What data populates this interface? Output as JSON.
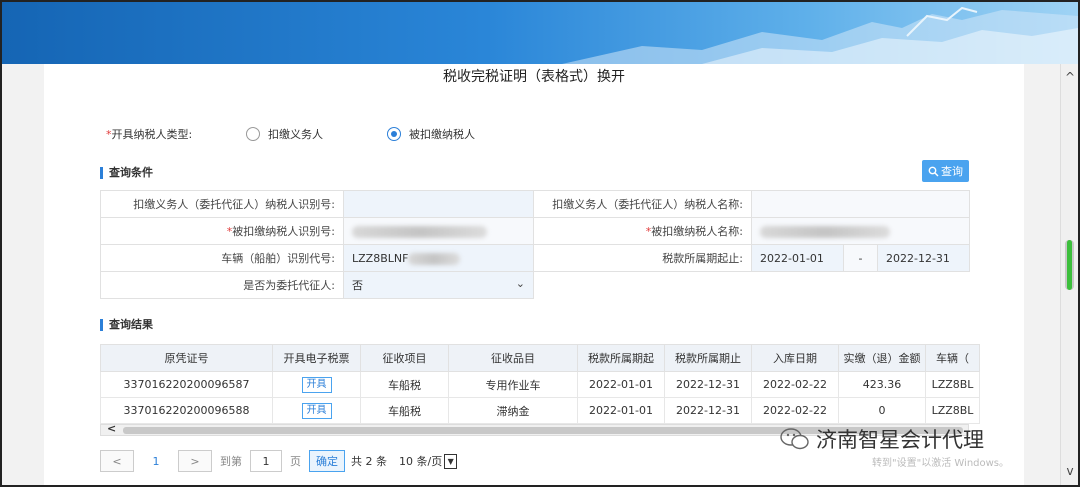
{
  "page_title": "税收完税证明（表格式）换开",
  "taxpayer_type": {
    "label": "开具纳税人类型:",
    "required_mark": "*",
    "options": [
      "扣缴义务人",
      "被扣缴纳税人"
    ],
    "selected": "被扣缴纳税人"
  },
  "query_section": {
    "title": "查询条件",
    "query_button": "查询",
    "row1": {
      "label_a": "扣缴义务人（委托代征人）纳税人识别号:",
      "value_a": "",
      "label_b": "扣缴义务人（委托代征人）纳税人名称:",
      "value_b": ""
    },
    "row2": {
      "label_a": "被扣缴纳税人识别号:",
      "label_b": "被扣缴纳税人名称:"
    },
    "row3": {
      "label_a": "车辆（船舶）识别代号:",
      "value_a": "LZZ8BLNF",
      "label_b": "税款所属期起止:",
      "date_from": "2022-01-01",
      "date_sep": "-",
      "date_to": "2022-12-31"
    },
    "row4": {
      "label_a": "是否为委托代征人:",
      "value_a": "否"
    }
  },
  "result_section": {
    "title": "查询结果",
    "columns": [
      "原凭证号",
      "开具电子税票",
      "征收项目",
      "征收品目",
      "税款所属期起",
      "税款所属期止",
      "入库日期",
      "实缴（退）金额",
      "车辆（"
    ],
    "rows": [
      [
        "337016220200096587",
        "开具",
        "车船税",
        "专用作业车",
        "2022-01-01",
        "2022-12-31",
        "2022-02-22",
        "423.36",
        "LZZ8BL"
      ],
      [
        "337016220200096588",
        "开具",
        "车船税",
        "滞纳金",
        "2022-01-01",
        "2022-12-31",
        "2022-02-22",
        "0",
        "LZZ8BL"
      ]
    ]
  },
  "pager": {
    "current_page": "1",
    "goto_label": "到第",
    "goto_value": "1",
    "page_unit": "页",
    "confirm": "确定",
    "total": "共 2 条",
    "page_size": "10 条/页"
  },
  "watermark": {
    "text": "济南智星会计代理",
    "sub": "转到\"设置\"以激活 Windows。"
  }
}
